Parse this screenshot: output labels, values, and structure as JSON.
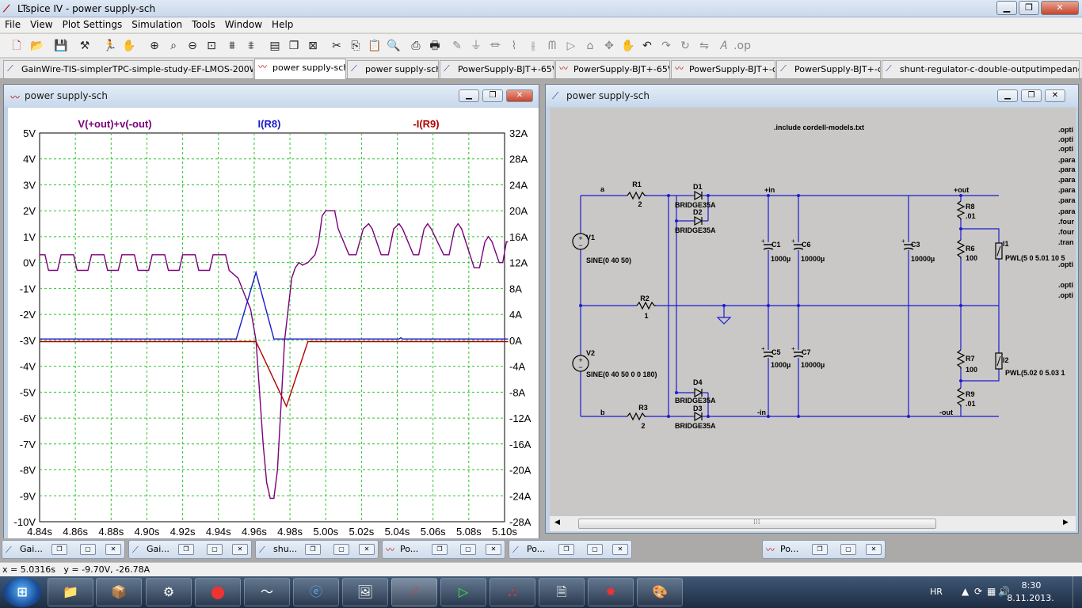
{
  "app": {
    "title": "LTspice IV - power supply-sch"
  },
  "menu": [
    "File",
    "View",
    "Plot Settings",
    "Simulation",
    "Tools",
    "Window",
    "Help"
  ],
  "tabs": [
    {
      "label": "GainWire-TIS-simplerTPC-simple-study-EF-LMOS-200W-final",
      "icon": "schematic-icon"
    },
    {
      "label": "power supply-sch",
      "icon": "waveform-icon"
    },
    {
      "label": "power supply-sch",
      "icon": "schematic-icon"
    },
    {
      "label": "PowerSupply-BJT+-65V",
      "icon": "schematic-icon"
    },
    {
      "label": "PowerSupply-BJT+-65V",
      "icon": "waveform-icon"
    },
    {
      "label": "PowerSupply-BJT+-c",
      "icon": "waveform-icon"
    },
    {
      "label": "PowerSupply-BJT+-c",
      "icon": "schematic-icon"
    },
    {
      "label": "shunt-regulator-c-double-outputimpedance",
      "icon": "schematic-icon"
    }
  ],
  "plot_window": {
    "title": "power supply-sch"
  },
  "schematic_window": {
    "title": "power supply-sch"
  },
  "chart_data": {
    "type": "line",
    "title": "",
    "x_ticks": [
      "4.84s",
      "4.86s",
      "4.88s",
      "4.90s",
      "4.92s",
      "4.94s",
      "4.96s",
      "4.98s",
      "5.00s",
      "5.02s",
      "5.04s",
      "5.06s",
      "5.08s",
      "5.10s"
    ],
    "xlim": [
      4.84,
      5.1
    ],
    "left_ticks": [
      "5V",
      "4V",
      "3V",
      "2V",
      "1V",
      "0V",
      "-1V",
      "-2V",
      "-3V",
      "-4V",
      "-5V",
      "-6V",
      "-7V",
      "-8V",
      "-9V",
      "-10V"
    ],
    "ylim_left": [
      -10,
      5
    ],
    "right_ticks": [
      "32A",
      "28A",
      "24A",
      "20A",
      "16A",
      "12A",
      "8A",
      "4A",
      "0A",
      "-4A",
      "-8A",
      "-12A",
      "-16A",
      "-20A",
      "-24A",
      "-28A"
    ],
    "ylim_right": [
      -28,
      32
    ],
    "grid": true,
    "series": [
      {
        "name": "V(+out)+v(-out)",
        "color": "#7a007a",
        "axis": "left",
        "points": [
          [
            4.84,
            0.3
          ],
          [
            4.843,
            0.3
          ],
          [
            4.845,
            -0.3
          ],
          [
            4.85,
            -0.3
          ],
          [
            4.852,
            0.3
          ],
          [
            4.859,
            0.3
          ],
          [
            4.861,
            -0.3
          ],
          [
            4.867,
            -0.3
          ],
          [
            4.869,
            0.3
          ],
          [
            4.876,
            0.3
          ],
          [
            4.878,
            -0.3
          ],
          [
            4.884,
            -0.3
          ],
          [
            4.886,
            0.3
          ],
          [
            4.893,
            0.3
          ],
          [
            4.895,
            -0.3
          ],
          [
            4.901,
            -0.3
          ],
          [
            4.903,
            0.3
          ],
          [
            4.91,
            0.3
          ],
          [
            4.912,
            -0.3
          ],
          [
            4.918,
            -0.3
          ],
          [
            4.92,
            0.3
          ],
          [
            4.927,
            0.3
          ],
          [
            4.929,
            -0.3
          ],
          [
            4.935,
            -0.3
          ],
          [
            4.937,
            0.3
          ],
          [
            4.944,
            0.3
          ],
          [
            4.946,
            -0.3
          ],
          [
            4.951,
            -0.6
          ],
          [
            4.955,
            -1.3
          ],
          [
            4.958,
            -1.8
          ],
          [
            4.961,
            -3.0
          ],
          [
            4.963,
            -5.0
          ],
          [
            4.965,
            -7.0
          ],
          [
            4.967,
            -8.5
          ],
          [
            4.969,
            -9.1
          ],
          [
            4.971,
            -9.1
          ],
          [
            4.973,
            -8.0
          ],
          [
            4.975,
            -5.5
          ],
          [
            4.977,
            -3.0
          ],
          [
            4.979,
            -1.8
          ],
          [
            4.981,
            -0.6
          ],
          [
            4.983,
            -0.2
          ],
          [
            4.985,
            0.0
          ],
          [
            4.987,
            -0.1
          ],
          [
            4.99,
            0.0
          ],
          [
            4.994,
            0.3
          ],
          [
            4.996,
            0.8
          ],
          [
            4.998,
            1.8
          ],
          [
            5.0,
            2.0
          ],
          [
            5.005,
            2.0
          ],
          [
            5.007,
            1.3
          ],
          [
            5.013,
            0.3
          ],
          [
            5.017,
            0.3
          ],
          [
            5.021,
            1.3
          ],
          [
            5.024,
            1.5
          ],
          [
            5.026,
            1.3
          ],
          [
            5.031,
            0.3
          ],
          [
            5.035,
            0.3
          ],
          [
            5.038,
            1.3
          ],
          [
            5.041,
            1.5
          ],
          [
            5.043,
            1.3
          ],
          [
            5.049,
            0.3
          ],
          [
            5.052,
            0.3
          ],
          [
            5.055,
            1.3
          ],
          [
            5.057,
            1.5
          ],
          [
            5.059,
            1.3
          ],
          [
            5.066,
            0.3
          ],
          [
            5.069,
            0.3
          ],
          [
            5.072,
            1.3
          ],
          [
            5.074,
            1.5
          ],
          [
            5.076,
            1.3
          ],
          [
            5.083,
            -0.2
          ],
          [
            5.086,
            -0.2
          ],
          [
            5.089,
            0.8
          ],
          [
            5.091,
            1.0
          ],
          [
            5.093,
            0.8
          ],
          [
            5.097,
            0.0
          ],
          [
            5.099,
            0.0
          ],
          [
            5.101,
            0.8
          ],
          [
            5.102,
            0.8
          ]
        ]
      },
      {
        "name": "I(R8)",
        "color": "#1a1acc",
        "axis": "right",
        "points": [
          [
            4.84,
            0.2
          ],
          [
            4.95,
            0.2
          ],
          [
            4.961,
            10.5
          ],
          [
            4.971,
            0.2
          ],
          [
            5.041,
            0.2
          ],
          [
            5.042,
            0.4
          ],
          [
            5.043,
            0.2
          ],
          [
            5.102,
            0.2
          ]
        ]
      },
      {
        "name": "-I(R9)",
        "color": "#b30000",
        "axis": "right",
        "points": [
          [
            4.84,
            -0.2
          ],
          [
            4.961,
            -0.2
          ],
          [
            4.978,
            -10.2
          ],
          [
            4.99,
            -0.2
          ],
          [
            5.102,
            -0.2
          ]
        ]
      }
    ]
  },
  "schematic": {
    "directive": ".include cordell-models.txt",
    "right_directives": [
      ".opti",
      ".opti",
      ".opti",
      ".para",
      ".para",
      ".para",
      ".para",
      ".para",
      ".para",
      ".four",
      ".four",
      ".tran",
      ".opti",
      ".opti",
      ".opti"
    ],
    "labels": [
      {
        "id": "net-a",
        "text": "a"
      },
      {
        "id": "net-b",
        "text": "b"
      },
      {
        "id": "r1",
        "text": "R1"
      },
      {
        "id": "r1v",
        "text": "2"
      },
      {
        "id": "r2",
        "text": "R2"
      },
      {
        "id": "r2v",
        "text": "1"
      },
      {
        "id": "r3",
        "text": "R3"
      },
      {
        "id": "r3v",
        "text": "2"
      },
      {
        "id": "d1",
        "text": "D1"
      },
      {
        "id": "d1v",
        "text": "BRIDGE35A"
      },
      {
        "id": "d2",
        "text": "D2"
      },
      {
        "id": "d2v",
        "text": "BRIDGE35A"
      },
      {
        "id": "d4",
        "text": "D4"
      },
      {
        "id": "d4v",
        "text": "BRIDGE35A"
      },
      {
        "id": "d3",
        "text": "D3"
      },
      {
        "id": "d3v",
        "text": "BRIDGE35A"
      },
      {
        "id": "v1",
        "text": "V1"
      },
      {
        "id": "v1v",
        "text": "SINE(0 40 50)"
      },
      {
        "id": "v2",
        "text": "V2"
      },
      {
        "id": "v2v",
        "text": "SINE(0 40 50 0 0 180)"
      },
      {
        "id": "c1",
        "text": "C1"
      },
      {
        "id": "c1v",
        "text": "1000µ"
      },
      {
        "id": "c6",
        "text": "C6"
      },
      {
        "id": "c6v",
        "text": "10000µ"
      },
      {
        "id": "c3",
        "text": "C3"
      },
      {
        "id": "c3v",
        "text": "10000µ"
      },
      {
        "id": "c5",
        "text": "C5"
      },
      {
        "id": "c5v",
        "text": "1000µ"
      },
      {
        "id": "c7",
        "text": "C7"
      },
      {
        "id": "c7v",
        "text": "10000µ"
      },
      {
        "id": "r8",
        "text": "R8"
      },
      {
        "id": "r8v",
        "text": ".01"
      },
      {
        "id": "r6",
        "text": "R6"
      },
      {
        "id": "r6v",
        "text": "100"
      },
      {
        "id": "r7",
        "text": "R7"
      },
      {
        "id": "r7v",
        "text": "100"
      },
      {
        "id": "r9",
        "text": "R9"
      },
      {
        "id": "r9v",
        "text": ".01"
      },
      {
        "id": "i1",
        "text": "I1"
      },
      {
        "id": "i1v",
        "text": "PWL(5 0 5.01 10 5"
      },
      {
        "id": "i2",
        "text": "I2"
      },
      {
        "id": "i2v",
        "text": "PWL(5.02 0 5.03 1"
      },
      {
        "id": "pin",
        "text": "+in"
      },
      {
        "id": "min",
        "text": "-in"
      },
      {
        "id": "pout",
        "text": "+out"
      },
      {
        "id": "mout",
        "text": "-out"
      }
    ]
  },
  "minimized_windows": [
    {
      "label": "Gai...",
      "icon": "schematic-icon"
    },
    {
      "label": "Gai...",
      "icon": "schematic-icon"
    },
    {
      "label": "shu...",
      "icon": "schematic-icon"
    },
    {
      "label": "Po...",
      "icon": "waveform-icon"
    },
    {
      "label": "Po...",
      "icon": "schematic-icon"
    },
    {
      "label": "Po...",
      "icon": "waveform-icon"
    }
  ],
  "status": {
    "text": "x = 5.0316s   y = -9.70V, -26.78A"
  },
  "tray": {
    "lang": "HR",
    "time": "8:30",
    "date": "8.11.2013."
  }
}
